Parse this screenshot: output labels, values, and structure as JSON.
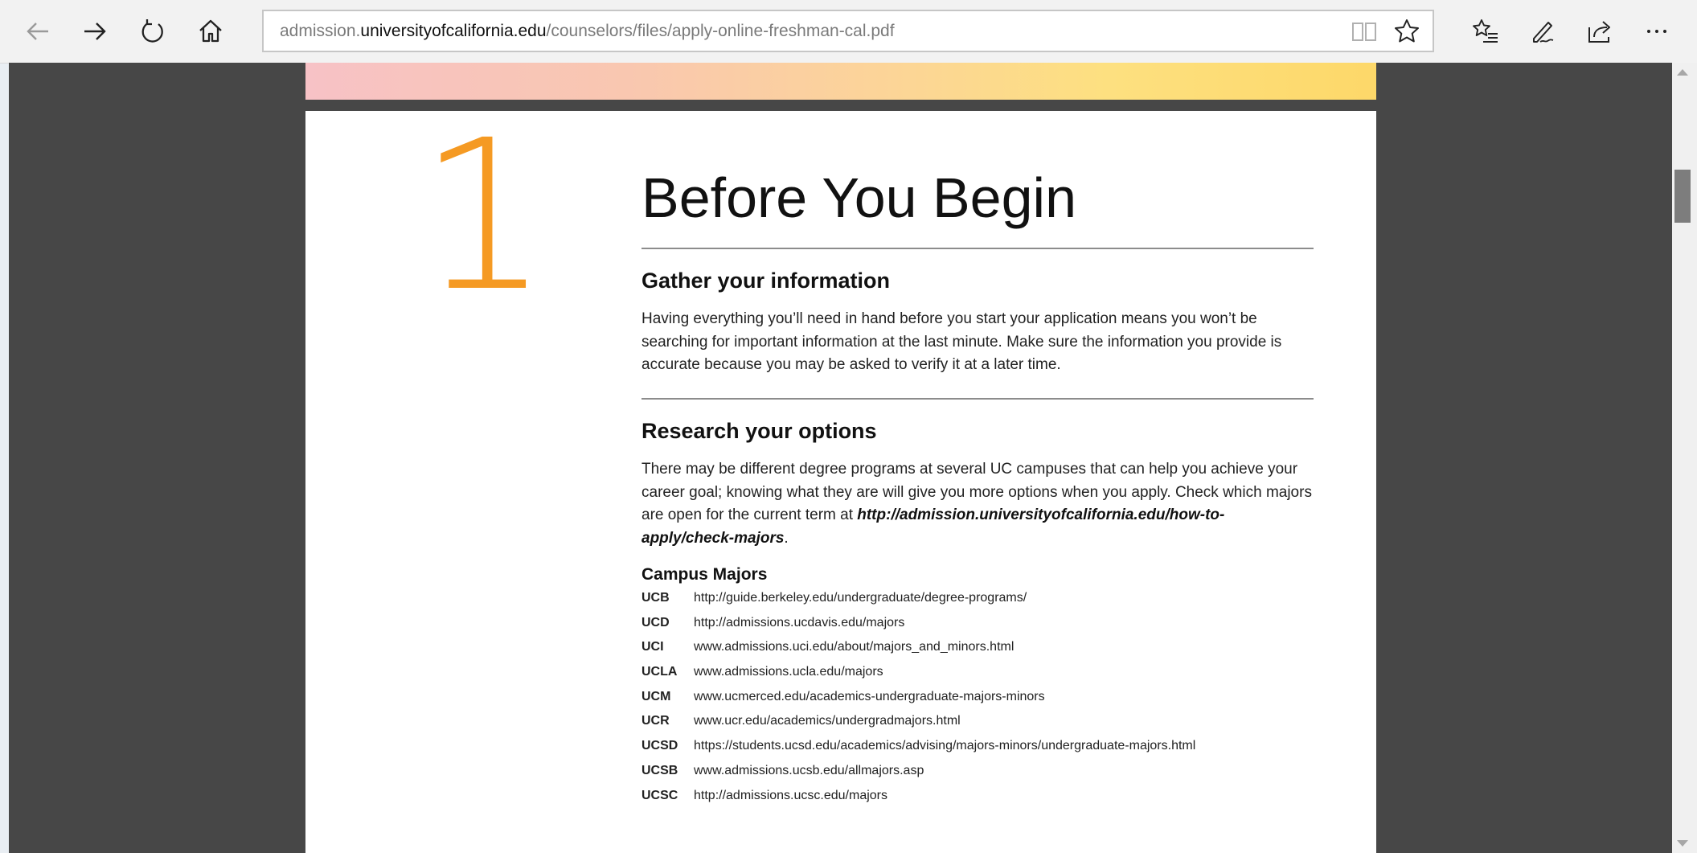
{
  "browser": {
    "url_prefix": "admission.",
    "url_domain": "universityofcalifornia.edu",
    "url_path": "/counselors/files/apply-online-freshman-cal.pdf",
    "icons": [
      "back-icon",
      "forward-icon",
      "refresh-icon",
      "home-icon",
      "reading-view-icon",
      "favorite-star-icon",
      "favorites-hub-icon",
      "pen-icon",
      "share-icon",
      "more-icon"
    ]
  },
  "page": {
    "step_number": "1",
    "title": "Before You Begin",
    "accent_color": "#f59a23",
    "sections": [
      {
        "heading": "Gather your information",
        "body": "Having everything you’ll need in hand before you start your application means you won’t be searching for important information at the last minute. Make sure the information you provide is accurate because you may be asked to verify it at a later time."
      },
      {
        "heading": "Research your options",
        "body_before_link": "There may be different degree programs at several UC campuses that can help you achieve your career goal; knowing what they are will give you more options when you apply. Check which majors are open for the current term at ",
        "link": "http://admission.universityofcalifornia.edu/how-to-apply/check-majors",
        "body_after_link": "."
      }
    ],
    "majors_heading": "Campus Majors",
    "majors": [
      {
        "code": "UCB",
        "url": "http://guide.berkeley.edu/undergraduate/degree-programs/"
      },
      {
        "code": "UCD",
        "url": "http://admissions.ucdavis.edu/majors"
      },
      {
        "code": "UCI",
        "url": "www.admissions.uci.edu/about/majors_and_minors.html"
      },
      {
        "code": "UCLA",
        "url": "www.admissions.ucla.edu/majors"
      },
      {
        "code": "UCM",
        "url": "www.ucmerced.edu/academics-undergraduate-majors-minors"
      },
      {
        "code": "UCR",
        "url": "www.ucr.edu/academics/undergradmajors.html"
      },
      {
        "code": "UCSD",
        "url": "https://students.ucsd.edu/academics/advising/majors-minors/undergraduate-majors.html"
      },
      {
        "code": "UCSB",
        "url": "www.admissions.ucsb.edu/allmajors.asp"
      },
      {
        "code": "UCSC",
        "url": "http://admissions.ucsc.edu/majors"
      }
    ]
  }
}
